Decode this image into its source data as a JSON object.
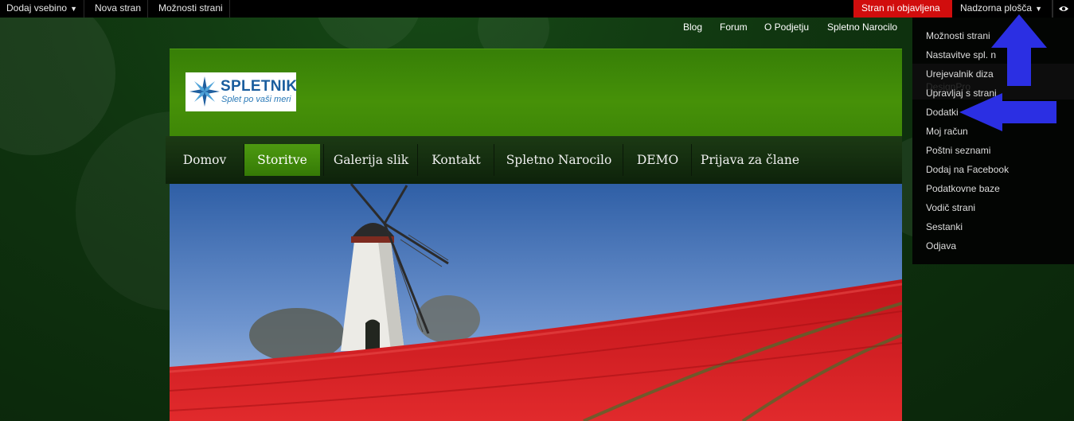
{
  "admin_bar": {
    "add_content": "Dodaj vsebino",
    "new_page": "Nova stran",
    "page_options": "Možnosti strani",
    "status": "Stran ni objavljena",
    "dashboard": "Nadzorna plošča"
  },
  "top_links": [
    "Blog",
    "Forum",
    "O Podjetju",
    "Spletno Narocilo"
  ],
  "logo": {
    "name": "SPLETNIK",
    "tagline": "Splet po vaši meri"
  },
  "nav": [
    "Domov",
    "Storitve",
    "Galerija slik",
    "Kontakt",
    "Spletno Narocilo",
    "DEMO",
    "Prijava za člane"
  ],
  "nav_active": "Storitve",
  "dashboard_menu": [
    "Možnosti strani",
    "Nastavitve spl. n",
    "Urejevalnik diza",
    "Upravljaj s strani",
    "Dodatki",
    "Moj račun",
    "Poštni seznami",
    "Dodaj na Facebook",
    "Podatkovne baze",
    "Vodič strani",
    "Sestanki",
    "Odjava"
  ],
  "ghost_text": "DesignPro",
  "colors": {
    "accent_red": "#d10d0d",
    "header_green": "#469108",
    "arrow_blue": "#2b2fe3",
    "background": "#0f330f"
  }
}
